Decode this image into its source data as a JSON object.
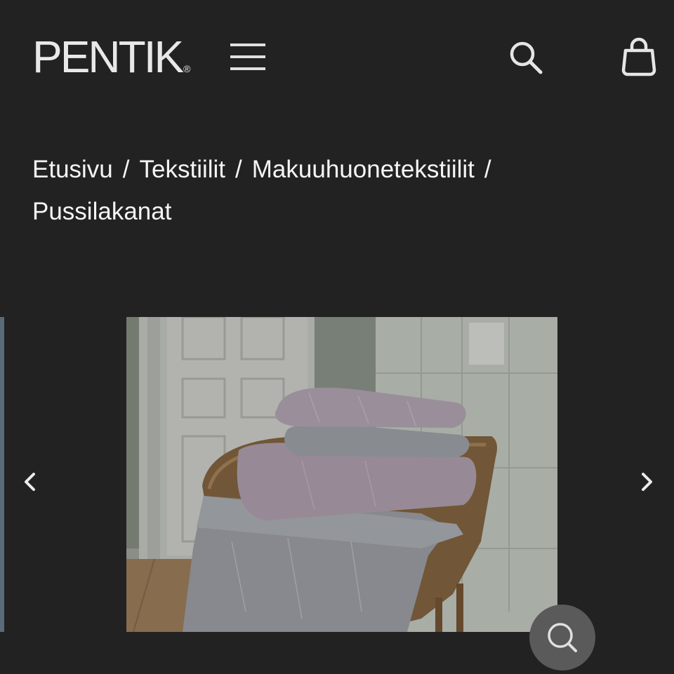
{
  "header": {
    "logo_text": "PENTIK",
    "logo_mark": "®",
    "menu_icon": "hamburger-menu-icon",
    "search_icon": "search-icon",
    "cart_icon": "shopping-bag-icon"
  },
  "breadcrumb": {
    "items": [
      "Etusivu",
      "Tekstiilit",
      "Makuuhuonetekstiilit",
      "Pussilakanat"
    ],
    "separator": "/"
  },
  "gallery": {
    "prev_icon": "chevron-left-icon",
    "next_icon": "chevron-right-icon",
    "zoom_icon": "zoom-icon",
    "image_subject": "Stack of pillows and duvet covers on a rattan chair"
  },
  "colors": {
    "background": "#222222",
    "text": "#f2f2f2",
    "bedding_lilac": "#b9a9b7",
    "bedding_grey": "#a7aab0"
  }
}
